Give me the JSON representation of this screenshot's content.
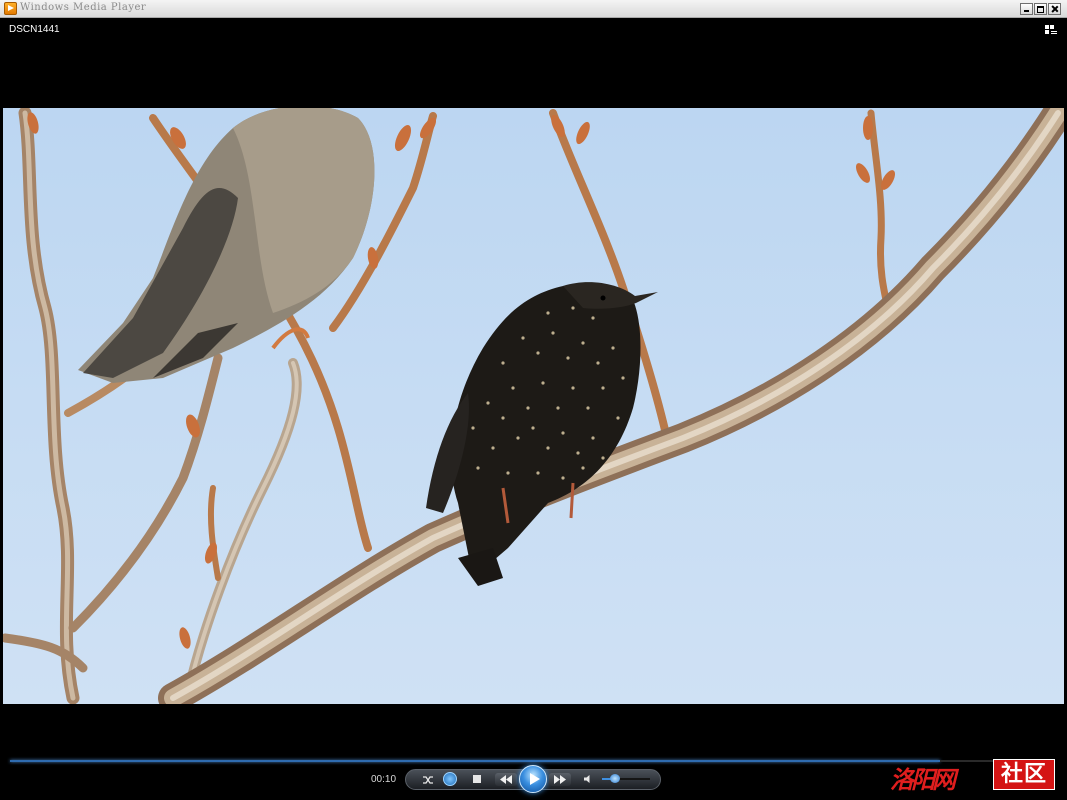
{
  "window": {
    "title": "Windows Media Player"
  },
  "player": {
    "media_title": "DSCN1441",
    "elapsed_time": "00:10",
    "progress_fraction": 0.89,
    "volume_fraction": 0.28,
    "state": "paused"
  },
  "icons": {
    "app": "media-player-icon",
    "minimize": "minimize-icon",
    "maximize": "maximize-icon",
    "close": "close-icon",
    "view": "switch-to-library-icon",
    "shuffle": "shuffle-icon",
    "repeat": "repeat-icon",
    "stop": "stop-icon",
    "previous": "previous-icon",
    "play": "play-icon",
    "next": "next-icon",
    "mute": "speaker-icon"
  },
  "colors": {
    "accent": "#3a8fe0",
    "sky": "#c6dcf3",
    "watermark": "#d41414"
  },
  "watermark": {
    "script_text": "洛阳网",
    "box_text": "社区"
  }
}
